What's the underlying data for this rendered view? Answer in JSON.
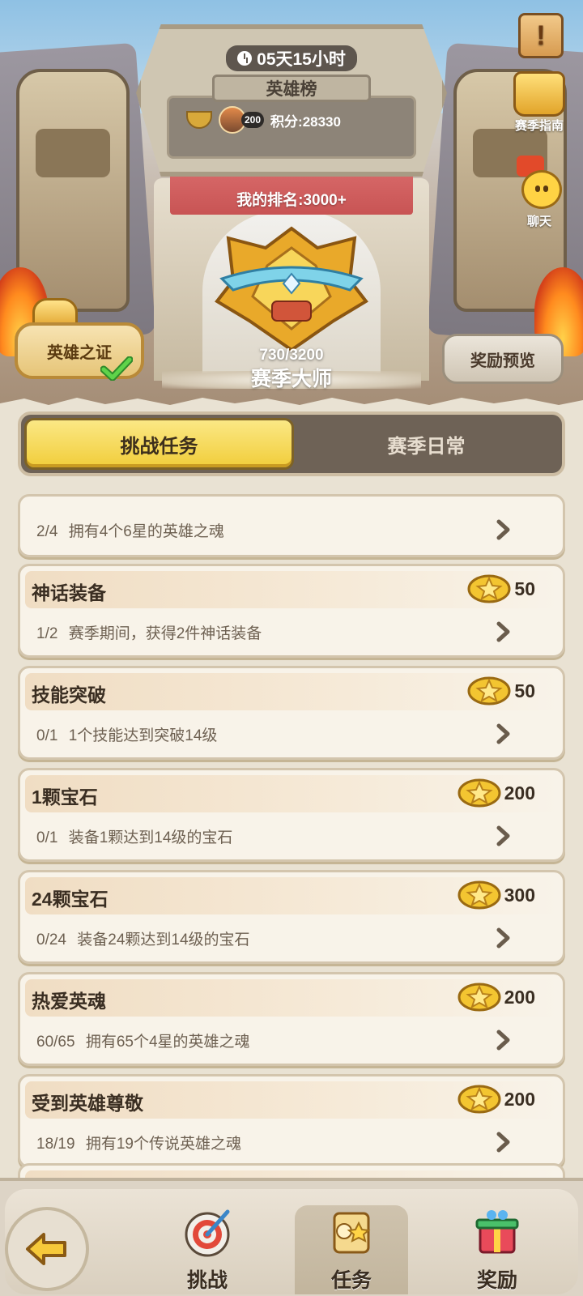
{
  "header": {
    "timer": "05天15小时",
    "leaderboard_title": "英雄榜",
    "top_player_level": "200",
    "top_player_score": "积分:28330",
    "my_rank": "我的排名:3000+",
    "progress": "730/3200",
    "rank_name": "赛季大师"
  },
  "side_buttons": {
    "notice_glyph": "!",
    "guide_label": "赛季指南",
    "chat_label": "聊天",
    "proof_label": "英雄之证",
    "preview_label": "奖励预览"
  },
  "tabs": [
    {
      "label": "挑战任务",
      "active": true
    },
    {
      "label": "赛季日常",
      "active": false
    }
  ],
  "tasks": [
    {
      "title": "",
      "progress": "2/4",
      "desc": "拥有4个6星的英雄之魂",
      "reward": ""
    },
    {
      "title": "神话装备",
      "progress": "1/2",
      "desc": "赛季期间，获得2件神话装备",
      "reward": "50"
    },
    {
      "title": "技能突破",
      "progress": "0/1",
      "desc": "1个技能达到突破14级",
      "reward": "50"
    },
    {
      "title": "1颗宝石",
      "progress": "0/1",
      "desc": "装备1颗达到14级的宝石",
      "reward": "200"
    },
    {
      "title": "24颗宝石",
      "progress": "0/24",
      "desc": "装备24颗达到14级的宝石",
      "reward": "300"
    },
    {
      "title": "热爱英魂",
      "progress": "60/65",
      "desc": "拥有65个4星的英雄之魂",
      "reward": "200"
    },
    {
      "title": "受到英雄尊敬",
      "progress": "18/19",
      "desc": "拥有19个传说英雄之魂",
      "reward": "200"
    }
  ],
  "bottom_nav": [
    {
      "label": "挑战",
      "icon": "target-icon"
    },
    {
      "label": "任务",
      "icon": "quest-scroll-icon",
      "active": true
    },
    {
      "label": "奖励",
      "icon": "gift-icon"
    }
  ],
  "colors": {
    "active_tab": "#f1cd3a",
    "tab_bar": "#6e6256",
    "card_bg": "#f8f3e9"
  }
}
